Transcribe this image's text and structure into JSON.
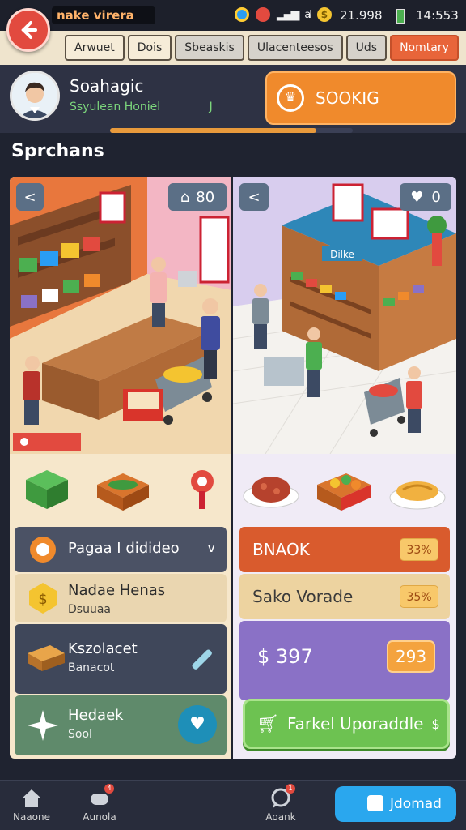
{
  "status": {
    "app_title": "nake virera",
    "coins": "21.998",
    "clock": "14:553",
    "coin_glyph": "$"
  },
  "tabs": [
    {
      "label": "Arwuet",
      "state": "normal"
    },
    {
      "label": "Dois",
      "state": "normal"
    },
    {
      "label": "Sbeaskis",
      "state": "gray"
    },
    {
      "label": "Ulacenteesos",
      "state": "gray"
    },
    {
      "label": "Uds",
      "state": "gray"
    },
    {
      "label": "Nomtary",
      "state": "active"
    }
  ],
  "profile": {
    "name": "Soahagic",
    "subtitle": "Ssyulean Honiel",
    "level_marker": "J",
    "progress": 0.85,
    "promo_label": "SOOKIG"
  },
  "section_title": "Sprchans",
  "left_panel": {
    "back_glyph": "<",
    "counter": "80",
    "list": [
      {
        "label": "Pagaa I didideo",
        "chevron": "v"
      },
      {
        "label": "Nadae Henas",
        "sub": "Dsuuaa"
      },
      {
        "label": "Kszolacet",
        "sub": "Banacot"
      },
      {
        "label": "Hedaek",
        "sub": "Sool"
      }
    ]
  },
  "right_panel": {
    "back_glyph": "<",
    "counter": "0",
    "store_sign": "Dilke",
    "rows": [
      {
        "label": "BNAOK",
        "badge": "33%"
      },
      {
        "label": "Sako Vorade",
        "badge": "35%"
      }
    ],
    "price": "$ 397",
    "price_badge": "293",
    "upgrade_label": "Farkel Uporaddle",
    "upgrade_glyph": "$"
  },
  "bottom_nav": [
    {
      "label": "Naaone",
      "icon": "home-icon",
      "badge": ""
    },
    {
      "label": "Aunola",
      "icon": "game-controller-icon",
      "badge": "4"
    },
    {
      "label": "Aoank",
      "icon": "chat-icon",
      "badge": "1"
    }
  ],
  "cta_label": "Jdomad",
  "colors": {
    "accent_orange": "#f08a2c",
    "accent_red": "#e24a3f",
    "accent_green": "#6dc251",
    "accent_blue": "#2aa7ee",
    "purple": "#8a71c6"
  }
}
